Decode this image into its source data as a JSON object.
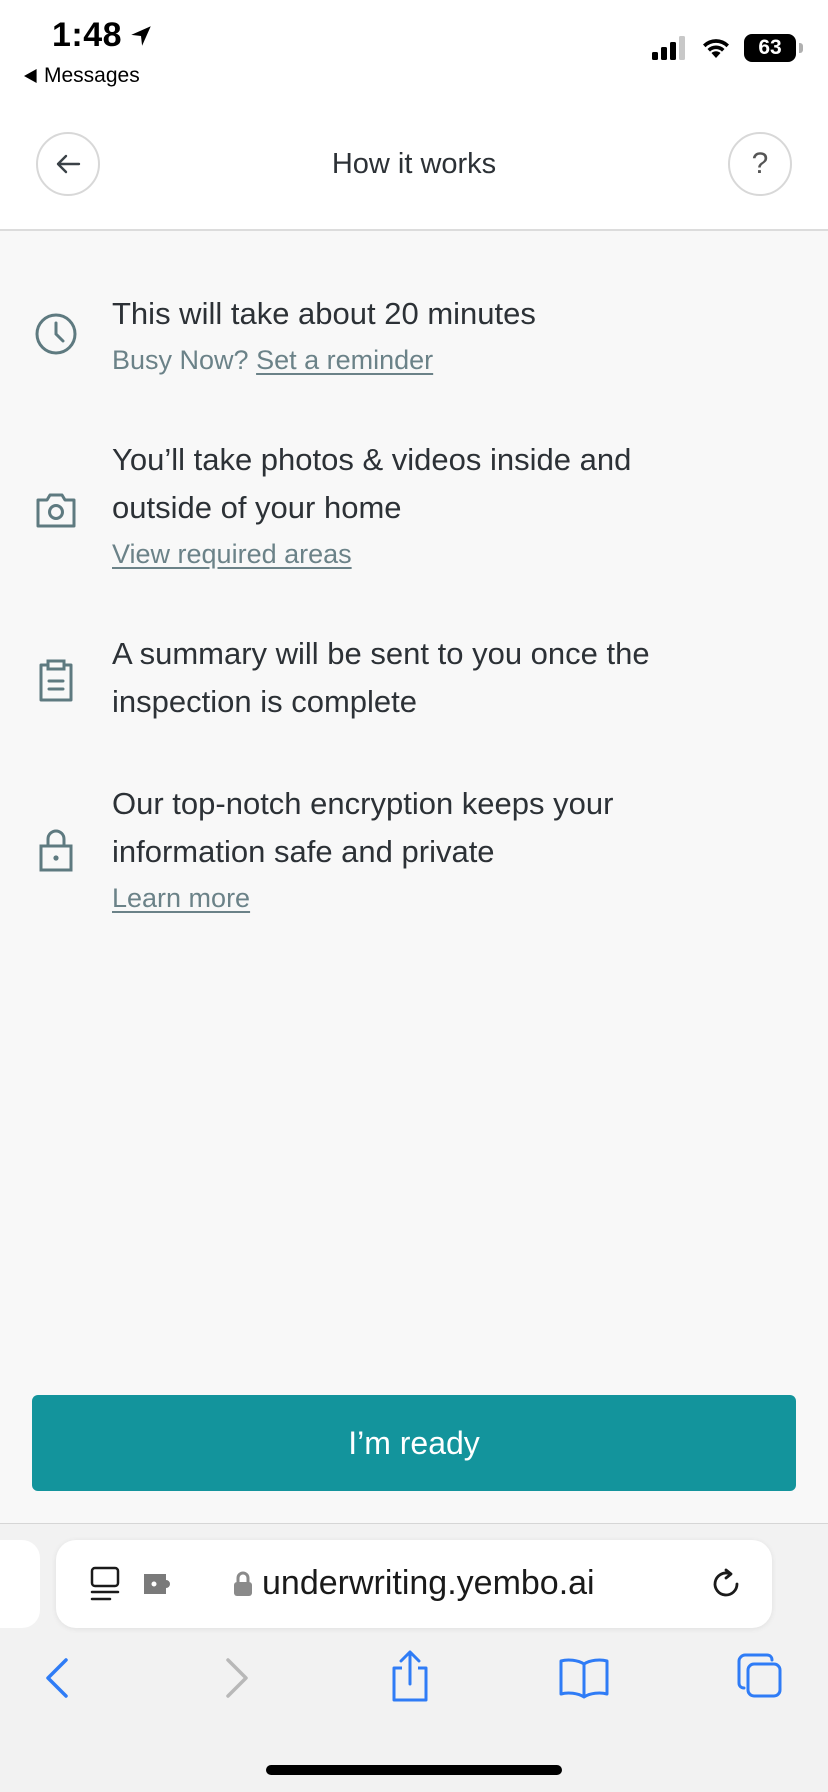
{
  "status_bar": {
    "time": "1:48",
    "back_app": "Messages",
    "battery": "63"
  },
  "header": {
    "title": "How it works",
    "help_label": "?"
  },
  "items": [
    {
      "icon": "clock-icon",
      "text": "This will take about 20 minutes",
      "sub_prefix": "Busy Now?",
      "link": "Set a reminder"
    },
    {
      "icon": "camera-icon",
      "text_line1": "You’ll take photos & videos inside and",
      "text_line2": "outside of your home",
      "link": "View required areas"
    },
    {
      "icon": "clipboard-icon",
      "text_line1": "A summary will be sent to you once the",
      "text_line2": "inspection is complete"
    },
    {
      "icon": "lock-icon",
      "text_line1": "Our top-notch encryption keeps your",
      "text_line2": "information safe and private",
      "link": "Learn more"
    }
  ],
  "cta": {
    "label": "I’m ready"
  },
  "browser": {
    "url": "underwriting.yembo.ai"
  },
  "colors": {
    "accent": "#13949c",
    "icon": "#5e7a80",
    "link": "#6b8288",
    "browser_blue": "#2f7cf6"
  }
}
